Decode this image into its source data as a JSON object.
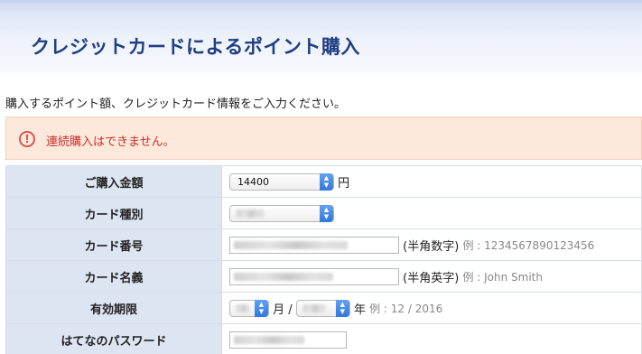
{
  "page": {
    "title": "クレジットカードによるポイント購入",
    "intro": "購入するポイント額、クレジットカード情報をご入力ください。"
  },
  "alert": {
    "icon": "!",
    "message": "連続購入はできません。"
  },
  "form": {
    "amount": {
      "label": "ご購入金額",
      "value": "14400",
      "unit": "円"
    },
    "card_type": {
      "label": "カード種別"
    },
    "card_number": {
      "label": "カード番号",
      "hint": "(半角数字)",
      "example": "例 : 1234567890123456"
    },
    "card_name": {
      "label": "カード名義",
      "hint": "(半角英字)",
      "example": "例 : John Smith"
    },
    "expiry": {
      "label": "有効期限",
      "month_unit": "月 /",
      "year_unit": "年",
      "example": "例 : 12 / 2016"
    },
    "password": {
      "label": "はてなのパスワード"
    }
  }
}
